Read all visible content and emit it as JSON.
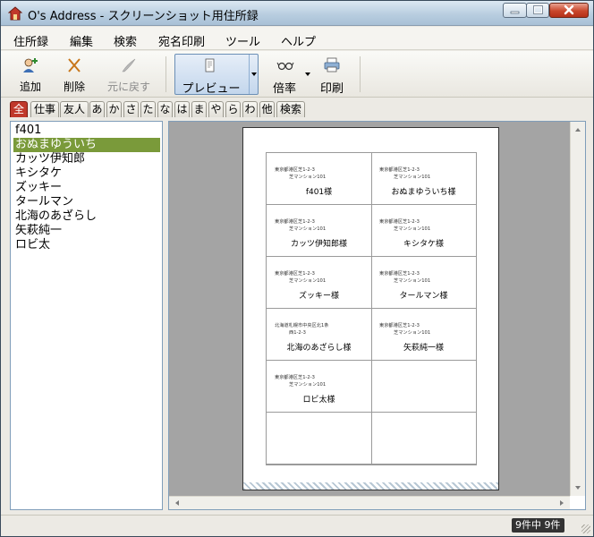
{
  "window": {
    "title": "O's Address - スクリーンショット用住所録"
  },
  "menu": {
    "items": [
      "住所録",
      "編集",
      "検索",
      "宛名印刷",
      "ツール",
      "ヘルプ"
    ]
  },
  "toolbar": {
    "add_label": "追加",
    "delete_label": "削除",
    "undo_label": "元に戻す",
    "preview_label": "プレビュー",
    "zoom_label": "倍率",
    "print_label": "印刷"
  },
  "tabs": [
    "全",
    "仕事",
    "友人",
    "あ",
    "か",
    "さ",
    "た",
    "な",
    "は",
    "ま",
    "や",
    "ら",
    "わ",
    "他",
    "検索"
  ],
  "active_tab": "全",
  "names": [
    "f401",
    "おぬまゆういち",
    "カッツ伊知郎",
    "キシタケ",
    "ズッキー",
    "タールマン",
    "北海のあざらし",
    "矢萩純一",
    "ロビ太"
  ],
  "selected_name": "おぬまゆういち",
  "labels": [
    {
      "addr1": "東京都港区芝1-2-3",
      "addr2": "芝マンション101",
      "name": "f401様"
    },
    {
      "addr1": "東京都港区芝1-2-3",
      "addr2": "芝マンション101",
      "name": "おぬまゆういち様"
    },
    {
      "addr1": "東京都港区芝1-2-3",
      "addr2": "芝マンション101",
      "name": "カッツ伊知郎様"
    },
    {
      "addr1": "東京都港区芝1-2-3",
      "addr2": "芝マンション101",
      "name": "キシタケ様"
    },
    {
      "addr1": "東京都港区芝1-2-3",
      "addr2": "芝マンション101",
      "name": "ズッキー様"
    },
    {
      "addr1": "東京都港区芝1-2-3",
      "addr2": "芝マンション101",
      "name": "タールマン様"
    },
    {
      "addr1": "北海道札幌市中央区北1条",
      "addr2": "西1-2-3",
      "name": "北海のあざらし様"
    },
    {
      "addr1": "東京都港区芝1-2-3",
      "addr2": "芝マンション101",
      "name": "矢萩純一様"
    },
    {
      "addr1": "東京都港区芝1-2-3",
      "addr2": "芝マンション101",
      "name": "ロビ太様"
    }
  ],
  "status": {
    "count": "9件中 9件"
  },
  "colors": {
    "selected": "#7a9a3a",
    "active_tab": "#c0392b",
    "preview_bg": "#a4a4a4"
  },
  "icons": {
    "app": "house-icon",
    "add": "person-add-icon",
    "delete": "cross-icon",
    "undo": "quill-icon",
    "preview": "preview-page-icon",
    "zoom": "glasses-icon",
    "print": "printer-icon"
  }
}
